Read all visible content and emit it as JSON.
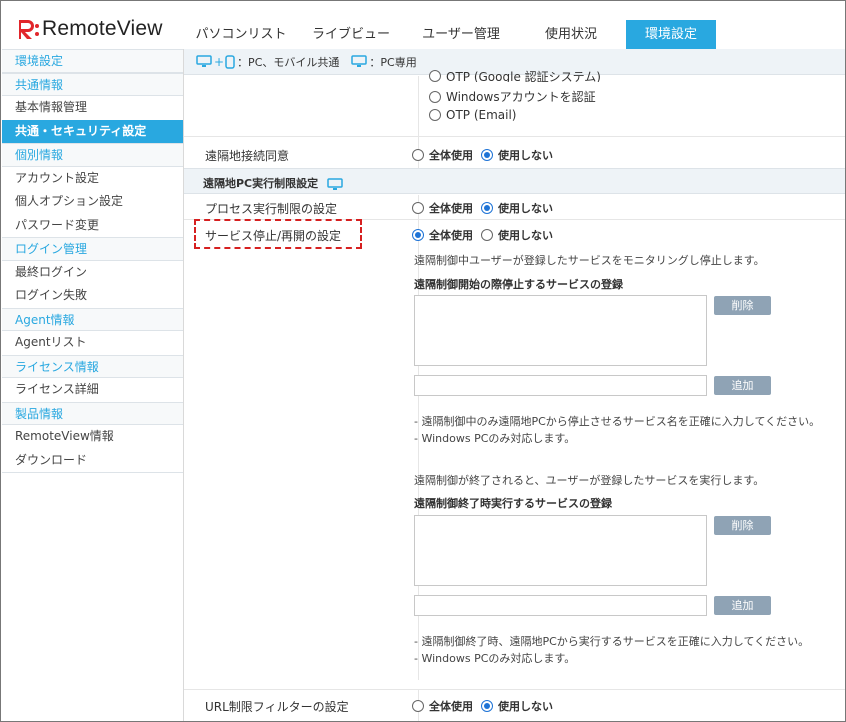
{
  "app": {
    "logo_text": "RemoteView",
    "brand_color": "#e1262b",
    "accent_color": "#29a8e0"
  },
  "nav": {
    "tabs": [
      {
        "label": "パソコンリスト",
        "active": false
      },
      {
        "label": "ライブビュー",
        "active": false
      },
      {
        "label": "ユーザー管理",
        "active": false
      },
      {
        "label": "使用状況",
        "active": false
      },
      {
        "label": "環境設定",
        "active": true
      }
    ]
  },
  "sidebar": {
    "items": [
      {
        "label": "環境設定",
        "kind": "cat"
      },
      {
        "label": "共通情報",
        "kind": "cat"
      },
      {
        "label": "基本情報管理",
        "kind": "sub"
      },
      {
        "label": "共通・セキュリティ設定",
        "kind": "active"
      },
      {
        "label": "個別情報",
        "kind": "cat"
      },
      {
        "label": "アカウント設定",
        "kind": "sub"
      },
      {
        "label": "個人オプション設定",
        "kind": "sub"
      },
      {
        "label": "パスワード変更",
        "kind": "sub"
      },
      {
        "label": "ログイン管理",
        "kind": "cat"
      },
      {
        "label": "最終ログイン",
        "kind": "sub"
      },
      {
        "label": "ログイン失敗",
        "kind": "sub"
      },
      {
        "label": "Agent情報",
        "kind": "cat"
      },
      {
        "label": "Agentリスト",
        "kind": "sub"
      },
      {
        "label": "ライセンス情報",
        "kind": "cat"
      },
      {
        "label": "ライセンス詳細",
        "kind": "sub"
      },
      {
        "label": "製品情報",
        "kind": "cat"
      },
      {
        "label": "RemoteView情報",
        "kind": "sub"
      },
      {
        "label": "ダウンロード",
        "kind": "sub"
      }
    ]
  },
  "legend": {
    "common_text": "：PC、モバイル共通",
    "pc_text": "：PC専用"
  },
  "auth_options": {
    "partial": "OTP (Google 認証システム)",
    "windows": "Windowsアカウントを認証",
    "otp_email": "OTP (Email)"
  },
  "remote_consent": {
    "label": "遠隔地接続同意",
    "opt_all": "全体使用",
    "opt_none": "使用しない",
    "selected": "none"
  },
  "section_title": "遠隔地PC実行制限設定",
  "process_limit": {
    "label": "プロセス実行制限の設定",
    "opt_all": "全体使用",
    "opt_none": "使用しない",
    "selected": "none"
  },
  "service_stop": {
    "label": "サービス停止/再開の設定",
    "opt_all": "全体使用",
    "opt_none": "使用しない",
    "selected": "all",
    "desc1": "遠隔制御中ユーザーが登録したサービスをモニタリングし停止します。",
    "title1": "遠隔制御開始の際停止するサービスの登録",
    "delete1": "削除",
    "add1": "追加",
    "note1a": "- 遠隔制御中のみ遠隔地PCから停止させるサービス名を正確に入力してください。",
    "note1b": "- Windows PCのみ対応します。",
    "desc2": "遠隔制御が終了されると、ユーザーが登録したサービスを実行します。",
    "title2": "遠隔制御終了時実行するサービスの登録",
    "delete2": "削除",
    "add2": "追加",
    "note2a": "- 遠隔制御終了時、遠隔地PCから実行するサービスを正確に入力してください。",
    "note2b": "- Windows PCのみ対応します。"
  },
  "url_filter": {
    "label": "URL制限フィルターの設定",
    "opt_all": "全体使用",
    "opt_none": "使用しない",
    "selected": "none"
  }
}
